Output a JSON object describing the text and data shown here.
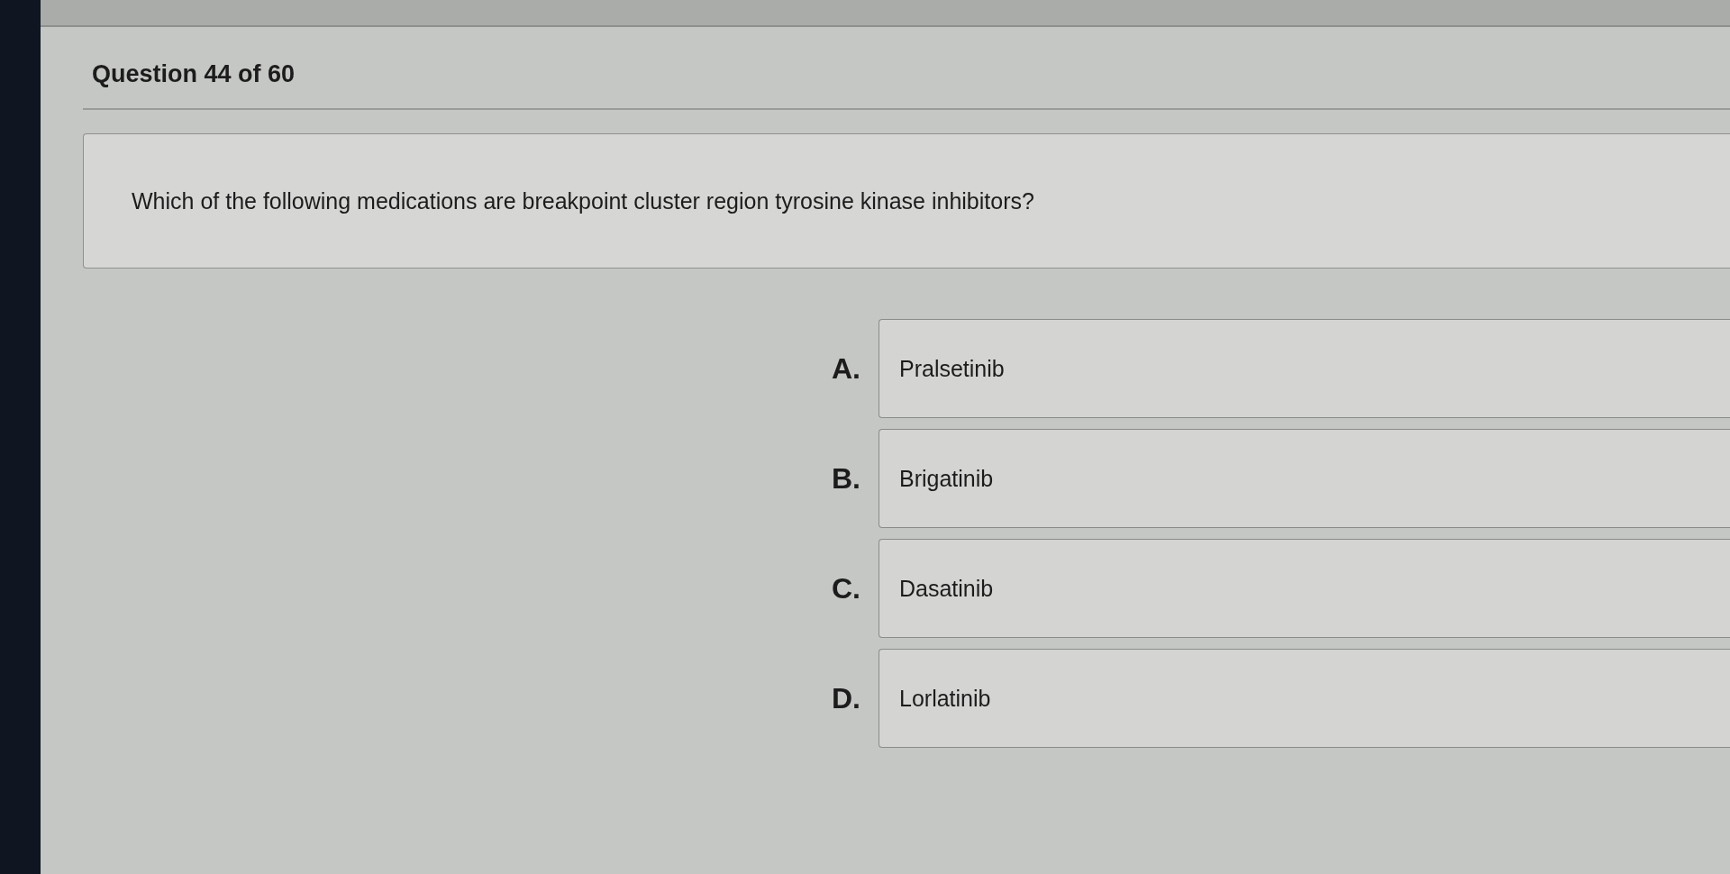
{
  "header": {
    "title": "Question 44 of 60"
  },
  "question": {
    "text": "Which of the following medications are breakpoint cluster region tyrosine kinase inhibitors?"
  },
  "options": [
    {
      "letter": "A.",
      "text": "Pralsetinib",
      "selected": false
    },
    {
      "letter": "B.",
      "text": "Brigatinib",
      "selected": false
    },
    {
      "letter": "C.",
      "text": "Dasatinib",
      "selected": false
    },
    {
      "letter": "D.",
      "text": "Lorlatinib",
      "selected": false
    }
  ]
}
